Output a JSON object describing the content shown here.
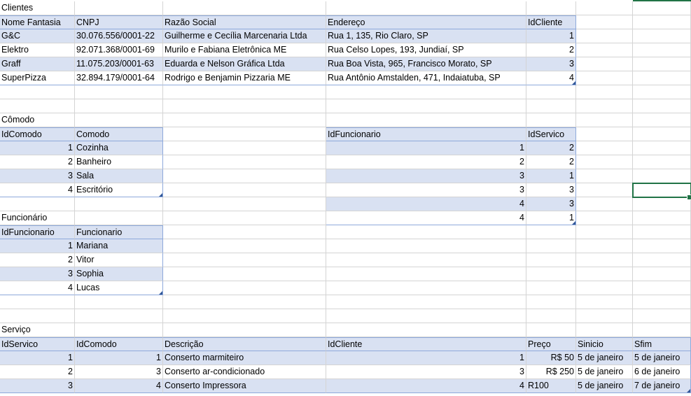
{
  "sheet": {
    "colors": {
      "header_band": "#d9e1f2",
      "table_border": "#8ea9db",
      "gridline": "#d4d4d4",
      "selection": "#217346"
    },
    "selected_cell": "G13",
    "cells": [
      {
        "c": 0,
        "r": 0,
        "t": "Clientes"
      },
      {
        "c": 0,
        "r": 1,
        "t": "Nome Fantasia"
      },
      {
        "c": 1,
        "r": 1,
        "t": "CNPJ"
      },
      {
        "c": 2,
        "r": 1,
        "t": "Razão Social"
      },
      {
        "c": 3,
        "r": 1,
        "t": "Endereço"
      },
      {
        "c": 4,
        "r": 1,
        "t": "IdCliente"
      },
      {
        "c": 0,
        "r": 2,
        "t": "G&C"
      },
      {
        "c": 1,
        "r": 2,
        "t": "30.076.556/0001-22"
      },
      {
        "c": 2,
        "r": 2,
        "t": "Guilherme e Cecília Marcenaria Ltda"
      },
      {
        "c": 3,
        "r": 2,
        "t": "Rua 1, 135, Rio Claro, SP"
      },
      {
        "c": 4,
        "r": 2,
        "t": "1",
        "n": 1
      },
      {
        "c": 0,
        "r": 3,
        "t": "Elektro"
      },
      {
        "c": 1,
        "r": 3,
        "t": "92.071.368/0001-69"
      },
      {
        "c": 2,
        "r": 3,
        "t": "Murilo e Fabiana Eletrônica ME"
      },
      {
        "c": 3,
        "r": 3,
        "t": "Rua Celso Lopes, 193, Jundiaí, SP"
      },
      {
        "c": 4,
        "r": 3,
        "t": "2",
        "n": 1
      },
      {
        "c": 0,
        "r": 4,
        "t": "Graff"
      },
      {
        "c": 1,
        "r": 4,
        "t": "11.075.203/0001-63"
      },
      {
        "c": 2,
        "r": 4,
        "t": "Eduarda e Nelson Gráfica Ltda"
      },
      {
        "c": 3,
        "r": 4,
        "t": "Rua Boa Vista, 965, Francisco Morato, SP"
      },
      {
        "c": 4,
        "r": 4,
        "t": "3",
        "n": 1
      },
      {
        "c": 0,
        "r": 5,
        "t": "SuperPizza"
      },
      {
        "c": 1,
        "r": 5,
        "t": "32.894.179/0001-64"
      },
      {
        "c": 2,
        "r": 5,
        "t": "Rodrigo e Benjamin Pizzaria ME"
      },
      {
        "c": 3,
        "r": 5,
        "t": "Rua Antônio Amstalden, 471, Indaiatuba, SP"
      },
      {
        "c": 4,
        "r": 5,
        "t": "4",
        "n": 1
      },
      {
        "c": 0,
        "r": 8,
        "t": "Cômodo"
      },
      {
        "c": 0,
        "r": 9,
        "t": "IdComodo"
      },
      {
        "c": 1,
        "r": 9,
        "t": "Comodo"
      },
      {
        "c": 0,
        "r": 10,
        "t": "1",
        "n": 1
      },
      {
        "c": 1,
        "r": 10,
        "t": "Cozinha"
      },
      {
        "c": 0,
        "r": 11,
        "t": "2",
        "n": 1
      },
      {
        "c": 1,
        "r": 11,
        "t": "Banheiro"
      },
      {
        "c": 0,
        "r": 12,
        "t": "3",
        "n": 1
      },
      {
        "c": 1,
        "r": 12,
        "t": "Sala"
      },
      {
        "c": 0,
        "r": 13,
        "t": "4",
        "n": 1
      },
      {
        "c": 1,
        "r": 13,
        "t": "Escritório"
      },
      {
        "c": 3,
        "r": 9,
        "t": "IdFuncionario"
      },
      {
        "c": 4,
        "r": 9,
        "t": "IdServico"
      },
      {
        "c": 3,
        "r": 10,
        "t": "1",
        "n": 1
      },
      {
        "c": 4,
        "r": 10,
        "t": "2",
        "n": 1
      },
      {
        "c": 3,
        "r": 11,
        "t": "2",
        "n": 1
      },
      {
        "c": 4,
        "r": 11,
        "t": "2",
        "n": 1
      },
      {
        "c": 3,
        "r": 12,
        "t": "3",
        "n": 1
      },
      {
        "c": 4,
        "r": 12,
        "t": "1",
        "n": 1
      },
      {
        "c": 3,
        "r": 13,
        "t": "3",
        "n": 1
      },
      {
        "c": 4,
        "r": 13,
        "t": "3",
        "n": 1
      },
      {
        "c": 3,
        "r": 14,
        "t": "4",
        "n": 1
      },
      {
        "c": 4,
        "r": 14,
        "t": "3",
        "n": 1
      },
      {
        "c": 3,
        "r": 15,
        "t": "4",
        "n": 1
      },
      {
        "c": 4,
        "r": 15,
        "t": "1",
        "n": 1
      },
      {
        "c": 0,
        "r": 15,
        "t": "Funcionário"
      },
      {
        "c": 0,
        "r": 16,
        "t": "IdFuncionario"
      },
      {
        "c": 1,
        "r": 16,
        "t": "Funcionario"
      },
      {
        "c": 0,
        "r": 17,
        "t": "1",
        "n": 1
      },
      {
        "c": 1,
        "r": 17,
        "t": "Mariana"
      },
      {
        "c": 0,
        "r": 18,
        "t": "2",
        "n": 1
      },
      {
        "c": 1,
        "r": 18,
        "t": "Vitor"
      },
      {
        "c": 0,
        "r": 19,
        "t": "3",
        "n": 1
      },
      {
        "c": 1,
        "r": 19,
        "t": "Sophia"
      },
      {
        "c": 0,
        "r": 20,
        "t": "4",
        "n": 1
      },
      {
        "c": 1,
        "r": 20,
        "t": "Lucas"
      },
      {
        "c": 0,
        "r": 23,
        "t": "Serviço"
      },
      {
        "c": 0,
        "r": 24,
        "t": "IdServico"
      },
      {
        "c": 1,
        "r": 24,
        "t": "IdComodo"
      },
      {
        "c": 2,
        "r": 24,
        "t": "Descrição"
      },
      {
        "c": 3,
        "r": 24,
        "t": "IdCliente"
      },
      {
        "c": 4,
        "r": 24,
        "t": "Preço"
      },
      {
        "c": 5,
        "r": 24,
        "t": "Sinicio"
      },
      {
        "c": 6,
        "r": 24,
        "t": "Sfim"
      },
      {
        "c": 0,
        "r": 25,
        "t": "1",
        "n": 1
      },
      {
        "c": 1,
        "r": 25,
        "t": "1",
        "n": 1
      },
      {
        "c": 2,
        "r": 25,
        "t": "Conserto marmiteiro"
      },
      {
        "c": 3,
        "r": 25,
        "t": "1",
        "n": 1
      },
      {
        "c": 4,
        "r": 25,
        "t": "R$ 50",
        "n": 1
      },
      {
        "c": 5,
        "r": 25,
        "t": "5 de janeiro"
      },
      {
        "c": 6,
        "r": 25,
        "t": "5 de janeiro"
      },
      {
        "c": 0,
        "r": 26,
        "t": "2",
        "n": 1
      },
      {
        "c": 1,
        "r": 26,
        "t": "3",
        "n": 1
      },
      {
        "c": 2,
        "r": 26,
        "t": "Conserto ar-condicionado"
      },
      {
        "c": 3,
        "r": 26,
        "t": "3",
        "n": 1
      },
      {
        "c": 4,
        "r": 26,
        "t": "R$ 250",
        "n": 1
      },
      {
        "c": 5,
        "r": 26,
        "t": "5 de janeiro"
      },
      {
        "c": 6,
        "r": 26,
        "t": "6 de janeiro"
      },
      {
        "c": 0,
        "r": 27,
        "t": "3",
        "n": 1
      },
      {
        "c": 1,
        "r": 27,
        "t": "4",
        "n": 1
      },
      {
        "c": 2,
        "r": 27,
        "t": "Conserto Impressora"
      },
      {
        "c": 3,
        "r": 27,
        "t": "4",
        "n": 1
      },
      {
        "c": 4,
        "r": 27,
        "t": "R100"
      },
      {
        "c": 5,
        "r": 27,
        "t": "5 de janeiro"
      },
      {
        "c": 6,
        "r": 27,
        "t": "7 de janeiro"
      }
    ]
  }
}
